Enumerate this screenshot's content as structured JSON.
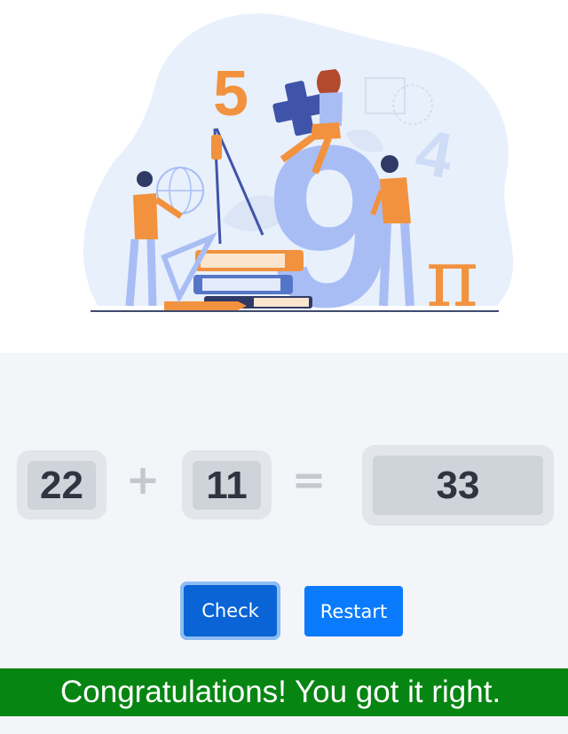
{
  "illustration": {
    "name": "math-study-illustration",
    "digits": [
      "5",
      "4",
      "9"
    ],
    "symbols": [
      "+",
      "π"
    ],
    "colors": {
      "blob": "#e8f0fb",
      "blue": "#a9bdf5",
      "orange": "#f2923e",
      "navy": "#2f3a66"
    }
  },
  "problem": {
    "operand1": "22",
    "operator": "+",
    "operand2": "11",
    "equals": "=",
    "answer": "33"
  },
  "buttons": {
    "check": "Check",
    "restart": "Restart"
  },
  "result": {
    "message": "Congratulations! You got it right.",
    "color": "#078512"
  }
}
